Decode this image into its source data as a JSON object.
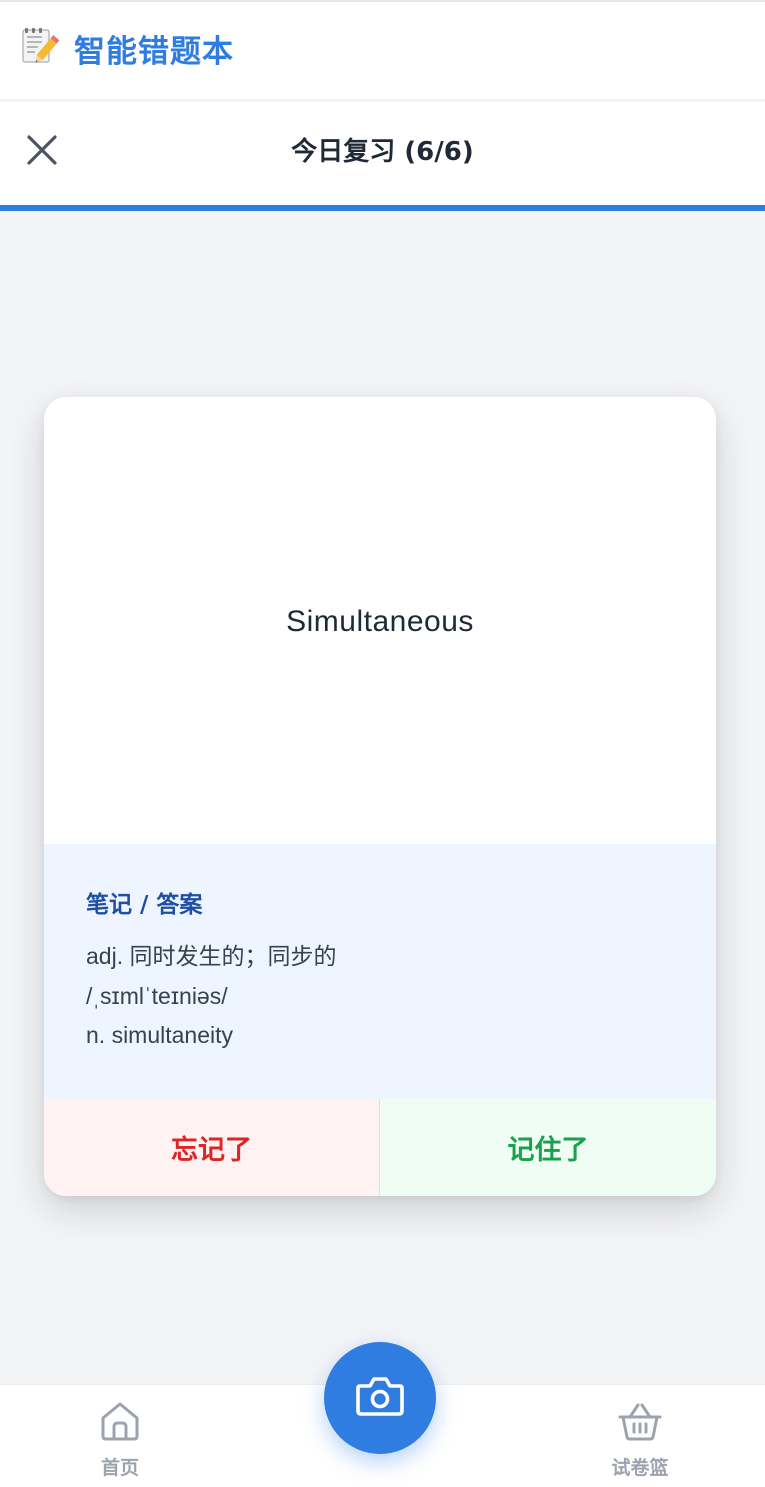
{
  "app": {
    "title": "智能错题本",
    "logo_icon": "memo-icon",
    "accent_color": "#2f7de1"
  },
  "review": {
    "title": "今日复习 (6/6)",
    "progress": 1.0
  },
  "card": {
    "word": "Simultaneous",
    "answer_heading": "笔记 / 答案",
    "answer_lines": [
      "adj. 同时发生的；同步的",
      "/ˌsɪmlˈteɪniəs/",
      "n. simultaneity"
    ],
    "forgot_label": "忘记了",
    "remember_label": "记住了"
  },
  "nav": {
    "home_label": "首页",
    "basket_label": "试卷篮",
    "camera_icon": "camera-icon"
  }
}
